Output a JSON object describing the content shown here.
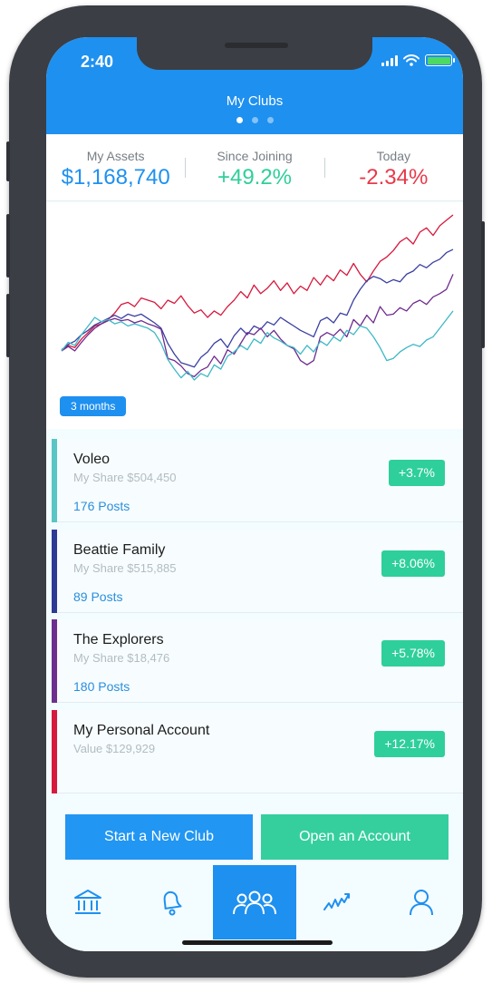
{
  "status": {
    "time": "2:40"
  },
  "header": {
    "title": "My Clubs",
    "page_count": 3,
    "active_page": 0
  },
  "stats": [
    {
      "label": "My Assets",
      "value": "$1,168,740",
      "color": "#1e90f0"
    },
    {
      "label": "Since Joining",
      "value": "+49.2%",
      "color": "#2ecf9a"
    },
    {
      "label": "Today",
      "value": "-2.34%",
      "color": "#e8394a"
    }
  ],
  "chart": {
    "range_label": "3 months",
    "chart_data": {
      "type": "line",
      "series": [
        {
          "color": "#d7193d",
          "values": [
            0.5,
            1.0,
            0.8,
            1.6,
            2.2,
            2.8,
            3.0,
            3.4,
            4.0,
            4.8,
            5.0,
            4.6,
            5.4,
            5.2,
            5.0,
            4.4,
            5.2,
            4.9,
            5.6,
            4.7,
            4.0,
            4.3,
            3.6,
            4.2,
            3.8,
            4.6,
            5.2,
            6.0,
            5.4,
            6.6,
            5.8,
            6.3,
            7.0,
            6.1,
            6.8,
            5.8,
            6.5,
            6.1,
            7.3,
            6.6,
            7.5,
            7.0,
            8.0,
            7.5,
            8.6,
            7.6,
            6.9,
            7.9,
            8.8,
            9.2,
            9.8,
            10.6,
            11.0,
            10.4,
            11.5,
            11.9,
            11.2,
            12.1,
            12.6,
            13.1
          ]
        },
        {
          "color": "#3a3fa1",
          "values": [
            0.6,
            1.1,
            1.4,
            2.0,
            2.4,
            2.9,
            3.2,
            3.5,
            3.8,
            3.5,
            3.9,
            3.7,
            3.9,
            3.5,
            3.1,
            2.6,
            1.2,
            0.2,
            -0.6,
            -0.8,
            -1.0,
            -0.1,
            0.4,
            1.2,
            1.6,
            0.8,
            1.9,
            2.6,
            2.0,
            2.8,
            2.5,
            3.2,
            2.9,
            3.6,
            3.2,
            2.8,
            2.4,
            2.1,
            1.8,
            3.3,
            3.6,
            3.1,
            4.0,
            3.8,
            5.2,
            6.2,
            7.0,
            7.4,
            7.2,
            6.8,
            7.1,
            6.9,
            7.6,
            7.9,
            8.5,
            8.2,
            8.7,
            9.0,
            9.6,
            9.9
          ]
        },
        {
          "color": "#6f2b8f",
          "values": [
            0.5,
            0.9,
            0.5,
            1.3,
            2.0,
            2.6,
            3.0,
            3.3,
            3.5,
            3.3,
            3.4,
            3.1,
            3.3,
            3.0,
            2.8,
            2.5,
            -0.2,
            -0.4,
            -0.9,
            -1.6,
            -1.9,
            -1.3,
            -1.0,
            0.0,
            -0.7,
            0.6,
            0.2,
            1.2,
            2.2,
            2.0,
            2.6,
            1.8,
            2.4,
            1.6,
            1.0,
            0.7,
            -0.4,
            -0.8,
            -0.4,
            1.8,
            2.2,
            1.9,
            2.5,
            1.8,
            3.4,
            2.8,
            3.8,
            3.1,
            4.6,
            3.8,
            3.9,
            4.5,
            4.2,
            4.9,
            5.2,
            4.8,
            5.5,
            5.8,
            6.2,
            7.6
          ]
        },
        {
          "color": "#3db8c6",
          "values": [
            0.5,
            1.3,
            1.0,
            2.0,
            2.8,
            3.6,
            3.2,
            3.4,
            3.0,
            3.2,
            2.8,
            3.0,
            2.8,
            2.6,
            2.2,
            1.2,
            -0.3,
            -1.2,
            -2.0,
            -1.4,
            -2.2,
            -1.6,
            -1.9,
            -0.8,
            -1.2,
            0.0,
            0.4,
            1.0,
            0.6,
            1.6,
            1.2,
            2.2,
            1.7,
            1.4,
            1.0,
            0.8,
            0.2,
            1.0,
            0.4,
            1.4,
            1.0,
            1.8,
            1.4,
            2.4,
            2.0,
            2.8,
            2.6,
            1.8,
            0.8,
            -0.4,
            -0.2,
            0.4,
            0.8,
            1.1,
            0.9,
            1.5,
            1.8,
            2.6,
            3.4,
            4.2
          ]
        }
      ]
    }
  },
  "clubs": [
    {
      "name": "Voleo",
      "share": "My Share $504,450",
      "posts": "176 Posts",
      "change": "+3.7%",
      "color": "#5bc4c4"
    },
    {
      "name": "Beattie Family",
      "share": "My Share $515,885",
      "posts": "89 Posts",
      "change": "+8.06%",
      "color": "#2d3a96"
    },
    {
      "name": "The Explorers",
      "share": "My Share $18,476",
      "posts": "180 Posts",
      "change": "+5.78%",
      "color": "#6d2f8f"
    },
    {
      "name": "My Personal Account",
      "share": "Value $129,929",
      "posts": "",
      "change": "+12.17%",
      "color": "#d7193d"
    }
  ],
  "actions": {
    "new_club": "Start a New Club",
    "open_account": "Open an Account"
  },
  "tabs": [
    {
      "icon": "bank-icon"
    },
    {
      "icon": "bell-icon"
    },
    {
      "icon": "group-icon",
      "active": true
    },
    {
      "icon": "trend-icon"
    },
    {
      "icon": "person-icon"
    }
  ]
}
